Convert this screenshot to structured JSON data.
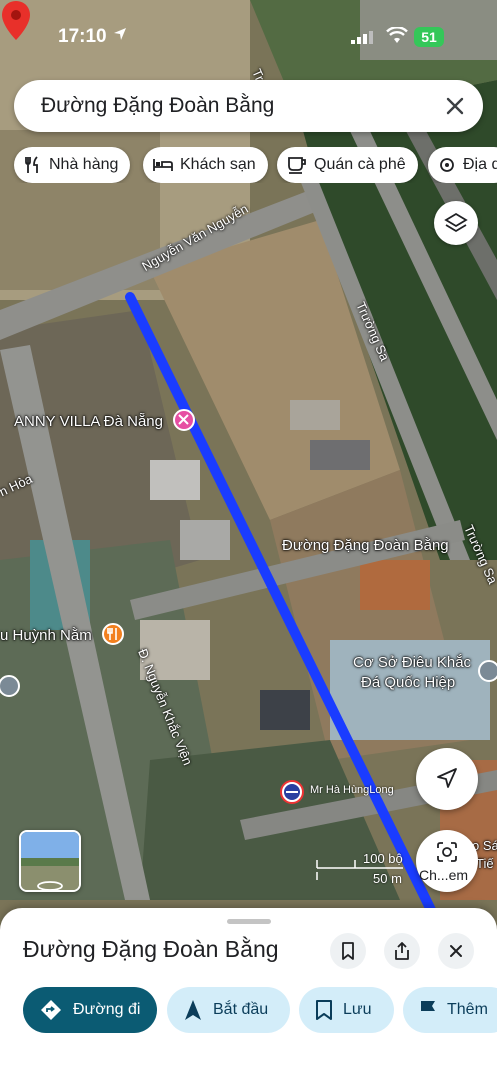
{
  "status_bar": {
    "time": "17:10",
    "battery": "51"
  },
  "search": {
    "query": "Đường Đặng Đoàn Bằng"
  },
  "chips": [
    {
      "label": "Nhà hàng",
      "icon": "fork-knife-icon"
    },
    {
      "label": "Khách sạn",
      "icon": "bed-icon"
    },
    {
      "label": "Quán cà phê",
      "icon": "coffee-icon"
    },
    {
      "label": "Địa d",
      "icon": "landmark-icon"
    }
  ],
  "map": {
    "roads": {
      "nguyen_van_nguyen": "Nguyễn Văn Nguyễn",
      "truong_sa_1": "Trường Sa",
      "truong_sa_2": "Trường Sa",
      "nguyen_khac_vien": "Đ. Nguyễn Khắc Viện",
      "hoa": "n Hòa",
      "tru_top": "Tr"
    },
    "places": {
      "anny_villa": "ANNY VILLA Đà Nẵng",
      "huynh_nam": "u Huỳnh Nằm",
      "co_so_1": "Cơ Sở Điêu Khắc",
      "co_so_2": "Đá Quốc Hiệp",
      "right_1": "o Sá",
      "right_2": "Tiế"
    },
    "pin_label": "Đường Đặng Đoàn Bằng",
    "user_label": "Mr Hà HùngLong",
    "scale": {
      "feet": "100 bộ",
      "meters": "50 m"
    },
    "lens_label": "Ch...em",
    "route_color": "#1a3cff",
    "pin_color": "#e8302a"
  },
  "sheet": {
    "title": "Đường Đặng Đoàn Bằng",
    "actions": [
      {
        "label": "Đường đi",
        "icon": "directions-icon"
      },
      {
        "label": "Bắt đầu",
        "icon": "navigation-arrow-icon"
      },
      {
        "label": "Lưu",
        "icon": "bookmark-icon"
      },
      {
        "label": "Thêm",
        "icon": "flag-icon"
      }
    ]
  }
}
